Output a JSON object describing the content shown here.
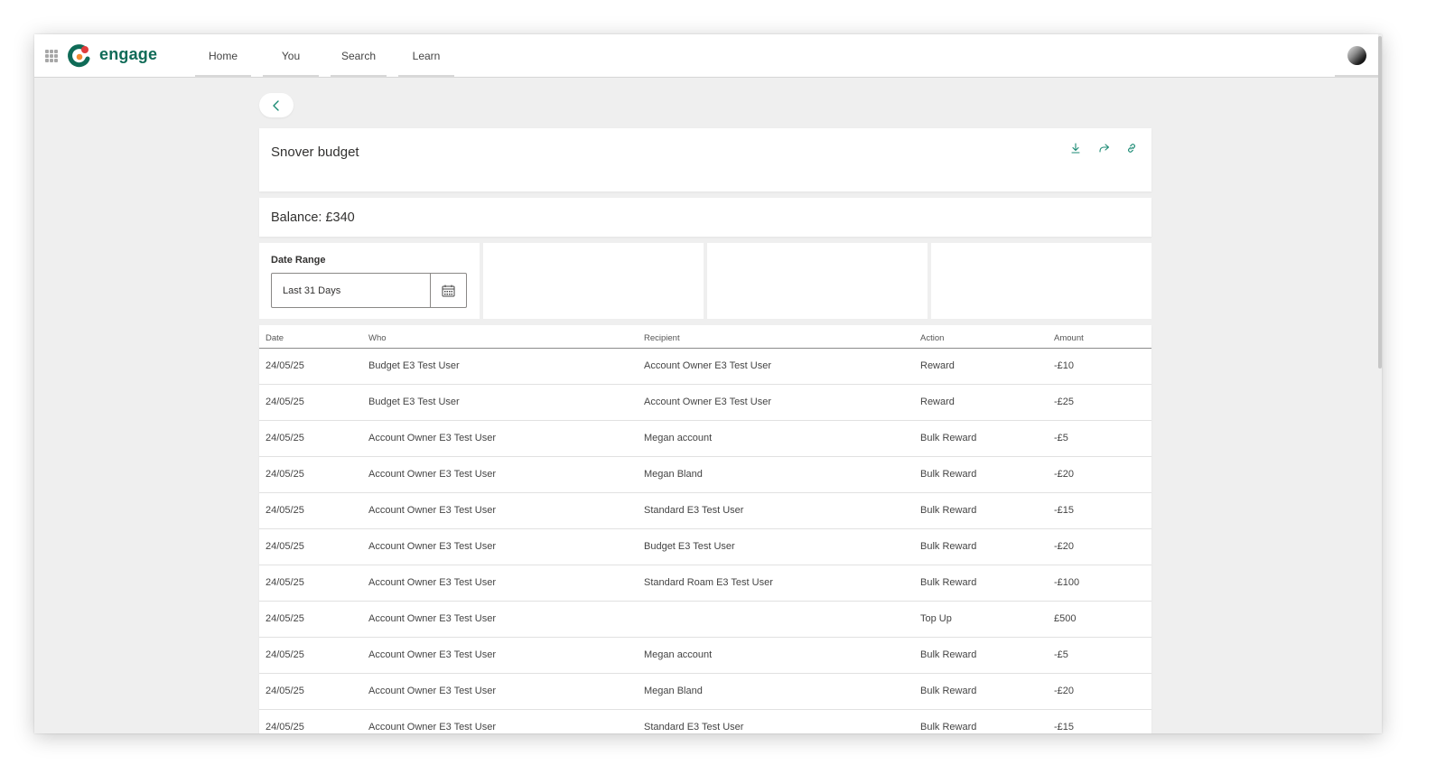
{
  "app": {
    "name": "engage"
  },
  "nav": {
    "items": [
      "Home",
      "You",
      "Search",
      "Learn"
    ]
  },
  "page": {
    "title": "Snover budget",
    "balance": "Balance: £340"
  },
  "filters": {
    "date_range_label": "Date Range",
    "date_range_value": "Last 31 Days"
  },
  "table": {
    "columns": [
      "Date",
      "Who",
      "Recipient",
      "Action",
      "Amount"
    ],
    "rows": [
      [
        "24/05/25",
        "Budget E3 Test User",
        "Account Owner E3 Test User",
        "Reward",
        "-£10"
      ],
      [
        "24/05/25",
        "Budget E3 Test User",
        "Account Owner E3 Test User",
        "Reward",
        "-£25"
      ],
      [
        "24/05/25",
        "Account Owner E3 Test User",
        "Megan account",
        "Bulk Reward",
        "-£5"
      ],
      [
        "24/05/25",
        "Account Owner E3 Test User",
        "Megan Bland",
        "Bulk Reward",
        "-£20"
      ],
      [
        "24/05/25",
        "Account Owner E3 Test User",
        "Standard E3 Test User",
        "Bulk Reward",
        "-£15"
      ],
      [
        "24/05/25",
        "Account Owner E3 Test User",
        "Budget E3 Test User",
        "Bulk Reward",
        "-£20"
      ],
      [
        "24/05/25",
        "Account Owner E3 Test User",
        "Standard Roam E3 Test User",
        "Bulk Reward",
        "-£100"
      ],
      [
        "24/05/25",
        "Account Owner E3 Test User",
        "",
        "Top Up",
        "£500"
      ],
      [
        "24/05/25",
        "Account Owner E3 Test User",
        "Megan account",
        "Bulk Reward",
        "-£5"
      ],
      [
        "24/05/25",
        "Account Owner E3 Test User",
        "Megan Bland",
        "Bulk Reward",
        "-£20"
      ],
      [
        "24/05/25",
        "Account Owner E3 Test User",
        "Standard E3 Test User",
        "Bulk Reward",
        "-£15"
      ]
    ]
  },
  "icons": {
    "waffle": "app-launcher-icon",
    "back": "chevron-left-icon",
    "download": "download-icon",
    "share": "share-icon",
    "link": "link-icon",
    "calendar": "calendar-icon"
  },
  "colors": {
    "brand": "#0f6b57",
    "accent": "#1a8a73",
    "logo_orange": "#f28b30",
    "logo_red": "#e03c3c"
  }
}
